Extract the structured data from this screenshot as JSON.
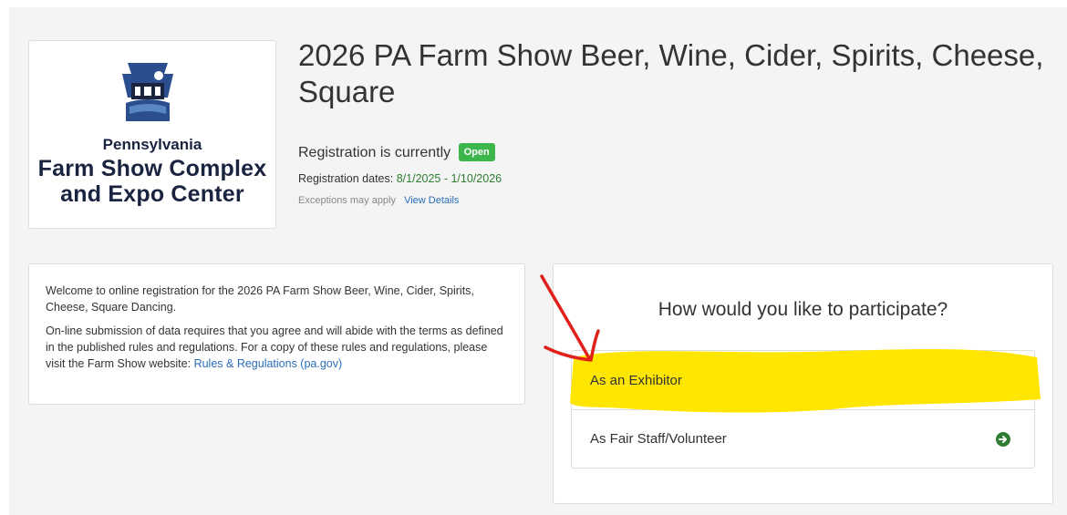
{
  "logo": {
    "line1": "Pennsylvania",
    "line2": "Farm Show Complex",
    "line3": "and Expo Center",
    "colors": {
      "navy": "#1a2340",
      "blue": "#2b4f8e"
    }
  },
  "header": {
    "title": "2026 PA Farm Show Beer, Wine, Cider, Spirits, Cheese, Square",
    "status_prefix": "Registration is currently",
    "status_badge": "Open",
    "dates_label": "Registration dates:",
    "dates_value": "8/1/2025 - 1/10/2026",
    "exceptions_text": "Exceptions may apply",
    "view_details_link": "View Details"
  },
  "welcome": {
    "paragraph1": "Welcome to online registration for the 2026 PA Farm Show Beer, Wine, Cider, Spirits, Cheese, Square Dancing.",
    "paragraph2": "On-line submission of data requires that you agree and will abide with the terms as defined in the published rules and regulations. For a copy of these rules and regulations, please visit the Farm Show website:",
    "rules_link": "Rules & Regulations (pa.gov)"
  },
  "participate": {
    "title": "How would you like to participate?",
    "options": [
      {
        "label": "As an Exhibitor",
        "icon": "arrow-right-circle-icon"
      },
      {
        "label": "As Fair Staff/Volunteer",
        "icon": "arrow-right-circle-icon"
      }
    ]
  },
  "colors": {
    "badge_green": "#3cb54a",
    "arrow_green": "#2e7d32",
    "link_blue": "#2a6ebb",
    "highlight_yellow": "#ffe600",
    "annotation_red": "#e0201b"
  }
}
